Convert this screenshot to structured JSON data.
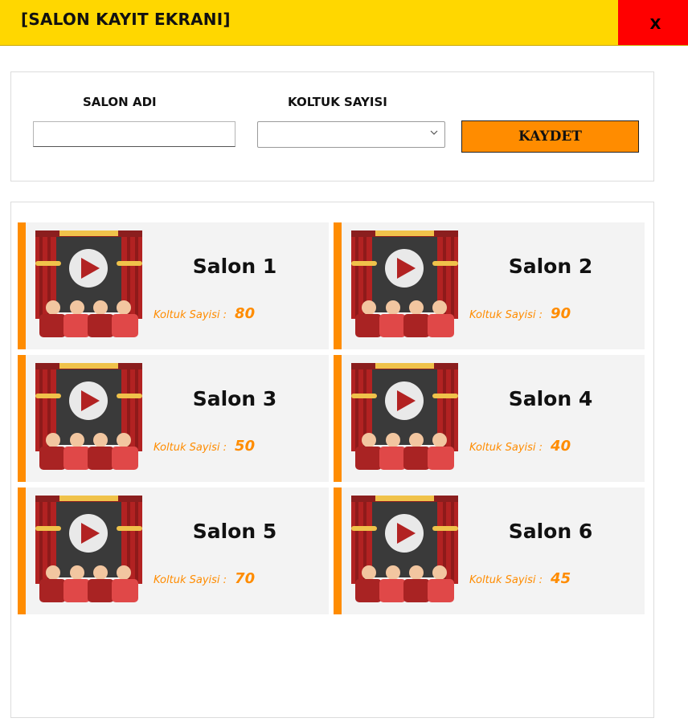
{
  "window": {
    "title": "[SALON KAYIT EKRANI]",
    "close_label": "X"
  },
  "form": {
    "salon_name_label": "SALON ADI",
    "salon_name_value": "",
    "seat_count_label": "KOLTUK SAYISI",
    "seat_count_value": "",
    "save_label": "KAYDET"
  },
  "salons": [
    {
      "name": "Salon 1",
      "seat_label": "Koltuk Sayisi :",
      "seats": "80"
    },
    {
      "name": "Salon 2",
      "seat_label": "Koltuk Sayisi :",
      "seats": "90"
    },
    {
      "name": "Salon 3",
      "seat_label": "Koltuk Sayisi :",
      "seats": "50"
    },
    {
      "name": "Salon 4",
      "seat_label": "Koltuk Sayisi :",
      "seats": "40"
    },
    {
      "name": "Salon 5",
      "seat_label": "Koltuk Sayisi :",
      "seats": "70"
    },
    {
      "name": "Salon 6",
      "seat_label": "Koltuk Sayisi :",
      "seats": "45"
    }
  ],
  "colors": {
    "titlebar": "#ffd700",
    "close_button": "#ff0000",
    "accent": "#ff8c00",
    "card_background": "#f3f3f3"
  },
  "icons": {
    "salon_thumbnail": "cinema-stage-icon",
    "select_arrow": "chevron-down-icon"
  }
}
